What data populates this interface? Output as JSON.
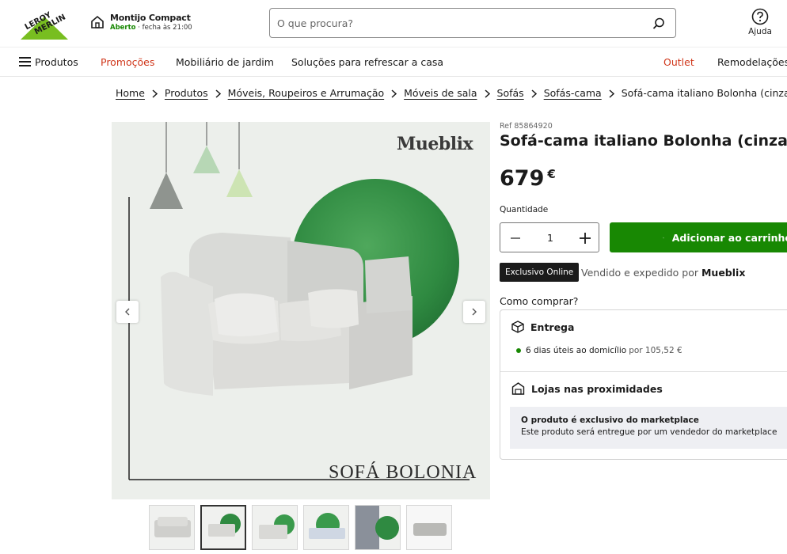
{
  "brand": {
    "logo_text": "LEROY MERLIN",
    "accent": "#188803",
    "promo_color": "#d0361a"
  },
  "store": {
    "name": "Montijo Compact",
    "status": "Aberto",
    "hours": " · fecha às 21:00"
  },
  "search": {
    "placeholder": "O que procura?"
  },
  "help": {
    "label": "Ajuda"
  },
  "nav": {
    "products": "Produtos",
    "promotions": "Promoções",
    "garden": "Mobiliário de jardim",
    "cooling": "Soluções para refrescar a casa",
    "outlet": "Outlet",
    "remodel": "Remodelações e"
  },
  "breadcrumb": [
    "Home",
    "Produtos",
    "Móveis, Roupeiros e Arrumação",
    "Móveis de sala",
    "Sofás",
    "Sofás-cama",
    "Sofá-cama italiano Bolonha (cinza)"
  ],
  "gallery": {
    "brand_mark": "Mueblix",
    "caption": "SOFÁ BOLONIA",
    "thumb_count": 6,
    "selected_thumb": 2
  },
  "product": {
    "ref": "Ref 85864920",
    "title": "Sofá-cama italiano Bolonha (cinza)",
    "price": "679",
    "currency": "€",
    "quantity_label": "Quantidade",
    "quantity": "1",
    "add_to_cart": "Adicionar ao carrinho",
    "badge": "Exclusivo Online",
    "seller_prefix": "Vendido e expedido por ",
    "seller": "Mueblix",
    "how_to_buy": "Como comprar?"
  },
  "delivery": {
    "title": "Entrega",
    "option": "6 dias úteis ao domicílio",
    "option_price": "por 105,52 €",
    "stores_title": "Lojas nas proximidades",
    "notice_title": "O produto é exclusivo do marketplace",
    "notice_text": "Este produto será entregue por um vendedor do marketplace"
  }
}
